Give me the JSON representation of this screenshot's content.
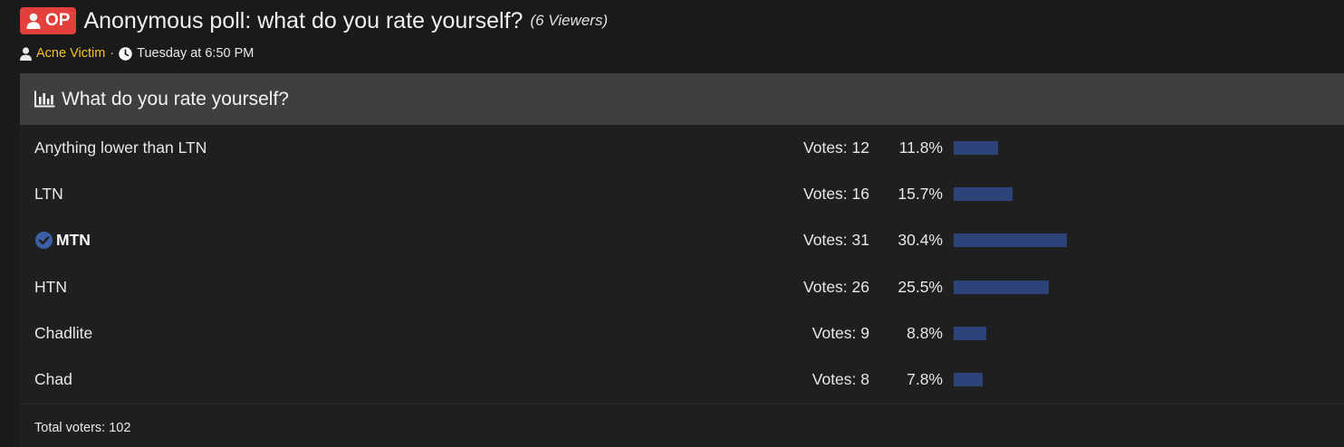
{
  "thread": {
    "badge": "OP",
    "title": "Anonymous poll: what do you rate yourself?",
    "viewers": "(6 Viewers)",
    "author": "Acne Victim",
    "separator": "·",
    "time": "Tuesday at 6:50 PM"
  },
  "poll": {
    "question": "What do you rate yourself?",
    "options": [
      {
        "label": "Anything lower than LTN",
        "votes": "Votes: 12",
        "percent": "11.8%",
        "fraction": 0.118,
        "voted": false
      },
      {
        "label": "LTN",
        "votes": "Votes: 16",
        "percent": "15.7%",
        "fraction": 0.157,
        "voted": false
      },
      {
        "label": "MTN",
        "votes": "Votes: 31",
        "percent": "30.4%",
        "fraction": 0.304,
        "voted": true
      },
      {
        "label": "HTN",
        "votes": "Votes: 26",
        "percent": "25.5%",
        "fraction": 0.255,
        "voted": false
      },
      {
        "label": "Chadlite",
        "votes": "Votes: 9",
        "percent": "8.8%",
        "fraction": 0.088,
        "voted": false
      },
      {
        "label": "Chad",
        "votes": "Votes: 8",
        "percent": "7.8%",
        "fraction": 0.078,
        "voted": false
      }
    ],
    "total_voters": "Total voters: 102"
  },
  "colors": {
    "op_badge": "#e3403c",
    "author": "#f5c518",
    "bar": "#2d4278",
    "check": "#3b5fa8"
  },
  "icons": {
    "badge": "user-icon",
    "author": "user-icon",
    "time": "clock-icon",
    "poll": "bar-chart-icon",
    "voted": "check-circle-icon"
  }
}
